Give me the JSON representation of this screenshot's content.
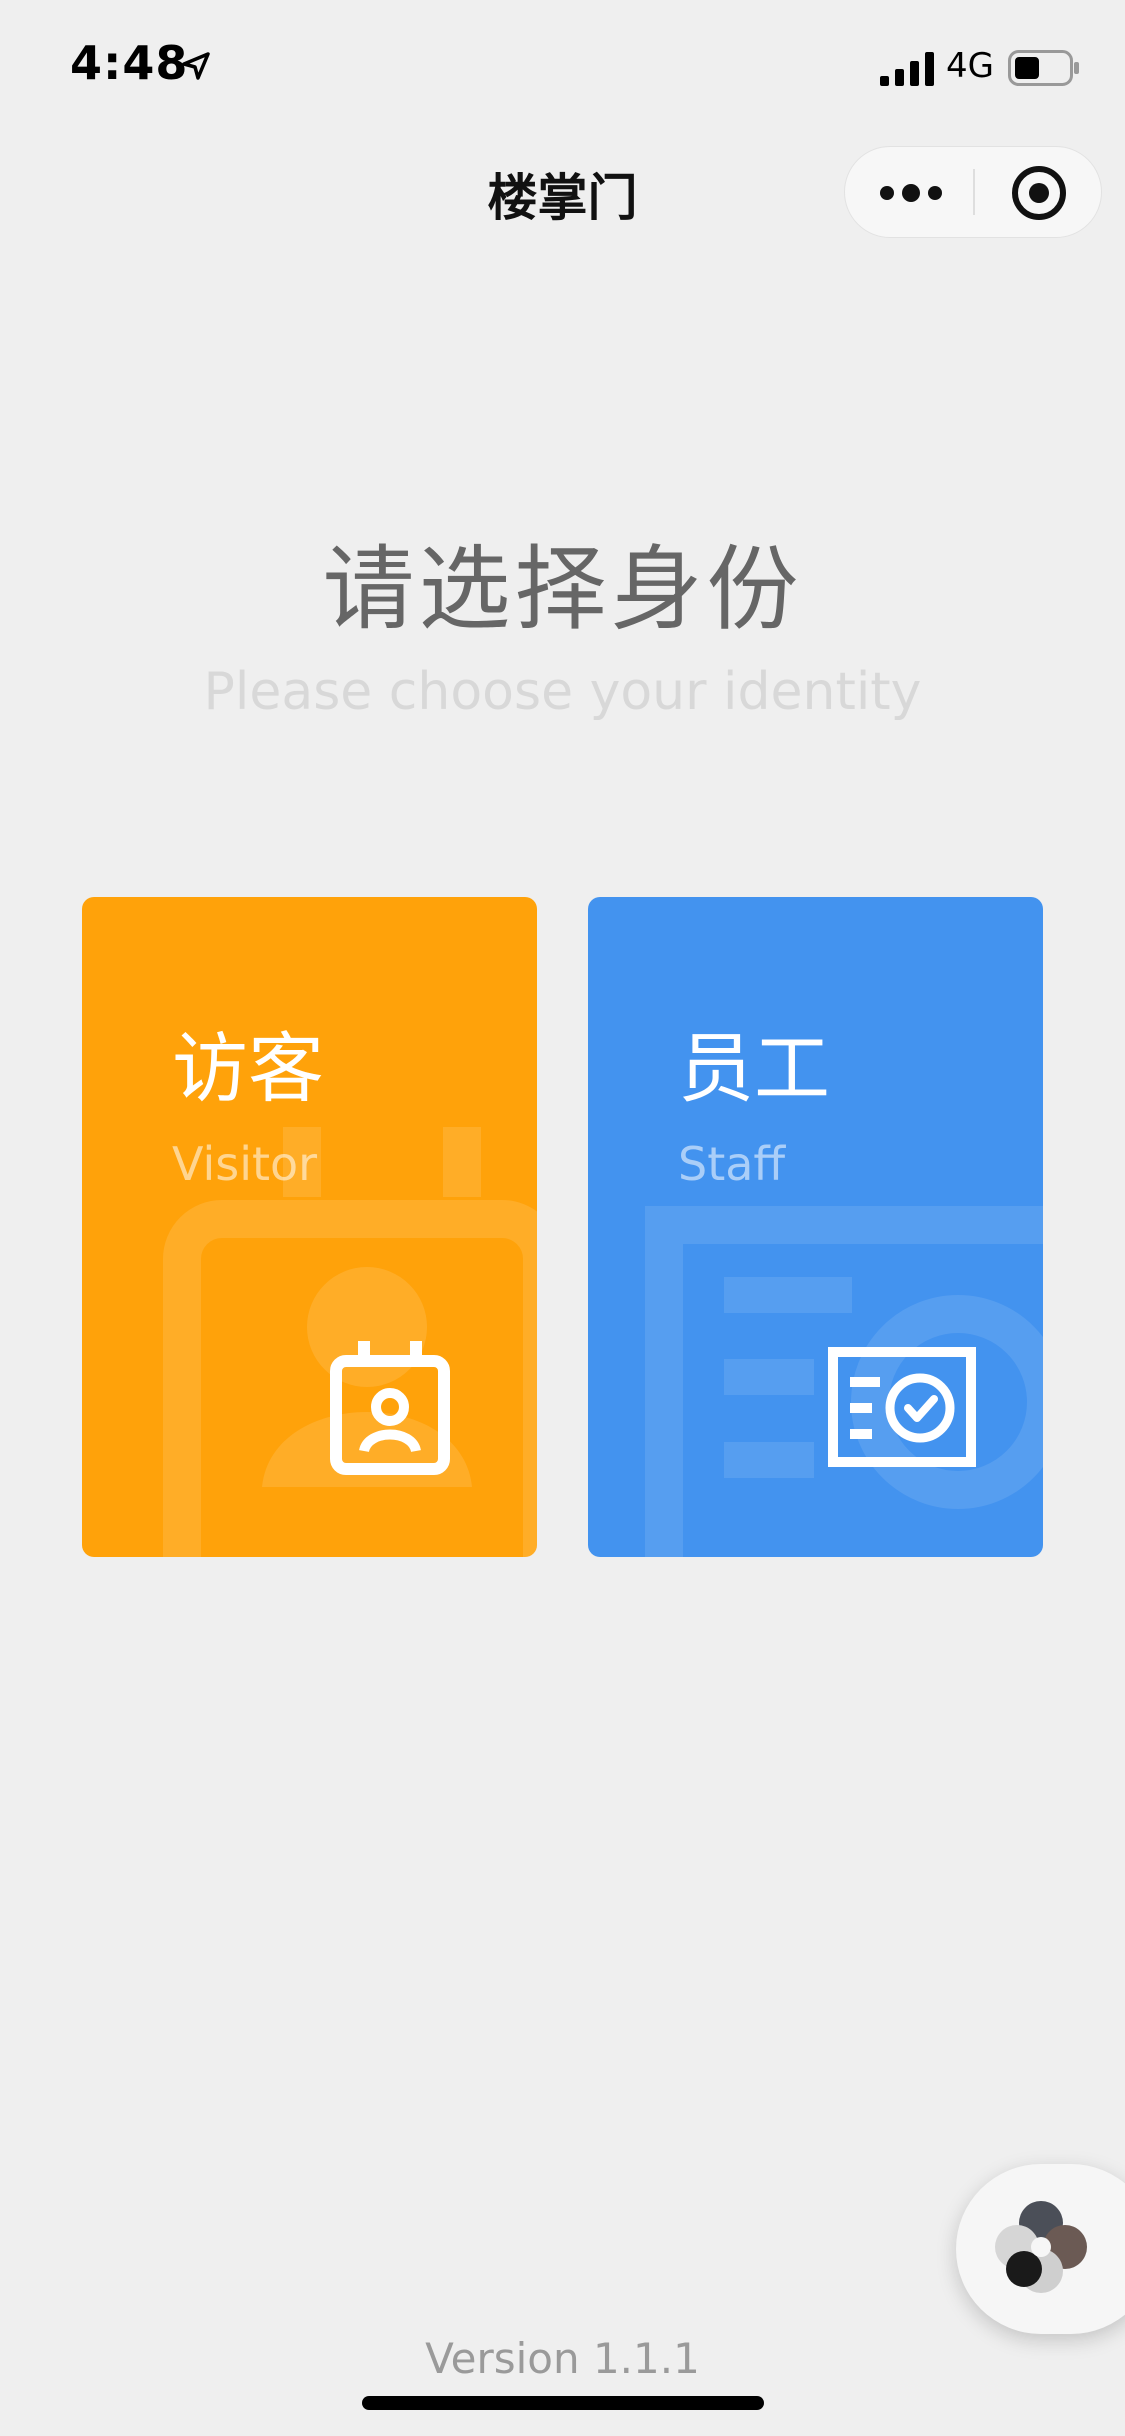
{
  "status_bar": {
    "time": "4:48",
    "network": "4G",
    "icons": [
      "location-arrow-icon",
      "signal-bars-icon",
      "battery-icon"
    ]
  },
  "nav": {
    "title": "楼掌门",
    "more_icon": "more-dots-icon",
    "close_icon": "close-target-icon"
  },
  "page": {
    "heading": "请选择身份",
    "subheading": "Please choose your identity"
  },
  "cards": [
    {
      "title": "访客",
      "subtitle": "Visitor",
      "color": "#ffa20a",
      "icon": "visitor-badge-icon"
    },
    {
      "title": "员工",
      "subtitle": "Staff",
      "color": "#4393ef",
      "icon": "staff-id-card-icon"
    }
  ],
  "float_button": {
    "icon": "assistant-logo-icon"
  },
  "footer": {
    "version": "Version 1.1.1"
  }
}
